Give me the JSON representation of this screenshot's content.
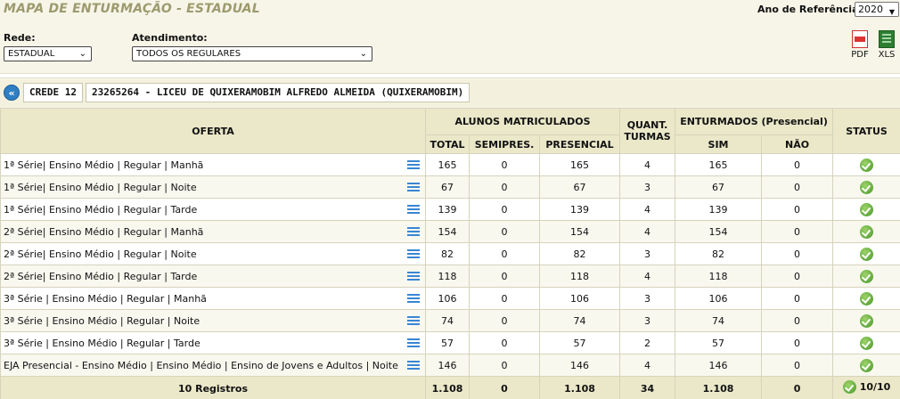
{
  "header": {
    "title": "MAPA DE ENTURMAÇÃO - ESTADUAL",
    "year_label": "Ano de Referência:",
    "year_value": "2020"
  },
  "filters": {
    "rede_label": "Rede:",
    "rede_value": "ESTADUAL",
    "atendimento_label": "Atendimento:",
    "atendimento_value": "TODOS OS REGULARES"
  },
  "export": {
    "pdf_label": "PDF",
    "xls_label": "XLS"
  },
  "breadcrumb": {
    "back_icon": "chevron-double-left-icon",
    "crede": "CREDE 12",
    "escola": "23265264 - LICEU DE QUIXERAMOBIM ALFREDO ALMEIDA (QUIXERAMOBIM)"
  },
  "table": {
    "headers": {
      "oferta": "OFERTA",
      "alunos_matriculados": "ALUNOS MATRICULADOS",
      "quant_turmas": "QUANT. TURMAS",
      "enturmados": "ENTURMADOS (Presencial)",
      "status": "STATUS",
      "total": "TOTAL",
      "semipres": "SEMIPRES.",
      "presencial": "PRESENCIAL",
      "sim": "SIM",
      "nao": "NÃO"
    },
    "rows": [
      {
        "oferta": "1ª Série| Ensino Médio | Regular | Manhã",
        "total": "165",
        "semipres": "0",
        "presencial": "165",
        "turmas": "4",
        "sim": "165",
        "nao": "0"
      },
      {
        "oferta": "1ª Série| Ensino Médio | Regular | Noite",
        "total": "67",
        "semipres": "0",
        "presencial": "67",
        "turmas": "3",
        "sim": "67",
        "nao": "0"
      },
      {
        "oferta": "1ª Série| Ensino Médio | Regular | Tarde",
        "total": "139",
        "semipres": "0",
        "presencial": "139",
        "turmas": "4",
        "sim": "139",
        "nao": "0"
      },
      {
        "oferta": "2ª Série| Ensino Médio | Regular | Manhã",
        "total": "154",
        "semipres": "0",
        "presencial": "154",
        "turmas": "4",
        "sim": "154",
        "nao": "0"
      },
      {
        "oferta": "2ª Série| Ensino Médio | Regular | Noite",
        "total": "82",
        "semipres": "0",
        "presencial": "82",
        "turmas": "3",
        "sim": "82",
        "nao": "0"
      },
      {
        "oferta": "2ª Série| Ensino Médio | Regular | Tarde",
        "total": "118",
        "semipres": "0",
        "presencial": "118",
        "turmas": "4",
        "sim": "118",
        "nao": "0"
      },
      {
        "oferta": "3ª Série | Ensino Médio | Regular | Manhã",
        "total": "106",
        "semipres": "0",
        "presencial": "106",
        "turmas": "3",
        "sim": "106",
        "nao": "0"
      },
      {
        "oferta": "3ª Série | Ensino Médio | Regular | Noite",
        "total": "74",
        "semipres": "0",
        "presencial": "74",
        "turmas": "3",
        "sim": "74",
        "nao": "0"
      },
      {
        "oferta": "3ª Série | Ensino Médio | Regular | Tarde",
        "total": "57",
        "semipres": "0",
        "presencial": "57",
        "turmas": "2",
        "sim": "57",
        "nao": "0"
      },
      {
        "oferta": "EJA Presencial - Ensino Médio | Ensino Médio | Ensino de Jovens e Adultos | Noite",
        "total": "146",
        "semipres": "0",
        "presencial": "146",
        "turmas": "4",
        "sim": "146",
        "nao": "0"
      }
    ],
    "row_detail_icon": "list-icon",
    "row_status_icon": "check-circle-icon",
    "footer": {
      "registros": "10 Registros",
      "total": "1.108",
      "semipres": "0",
      "presencial": "1.108",
      "turmas": "34",
      "sim": "1.108",
      "nao": "0",
      "status": "10/10"
    }
  }
}
